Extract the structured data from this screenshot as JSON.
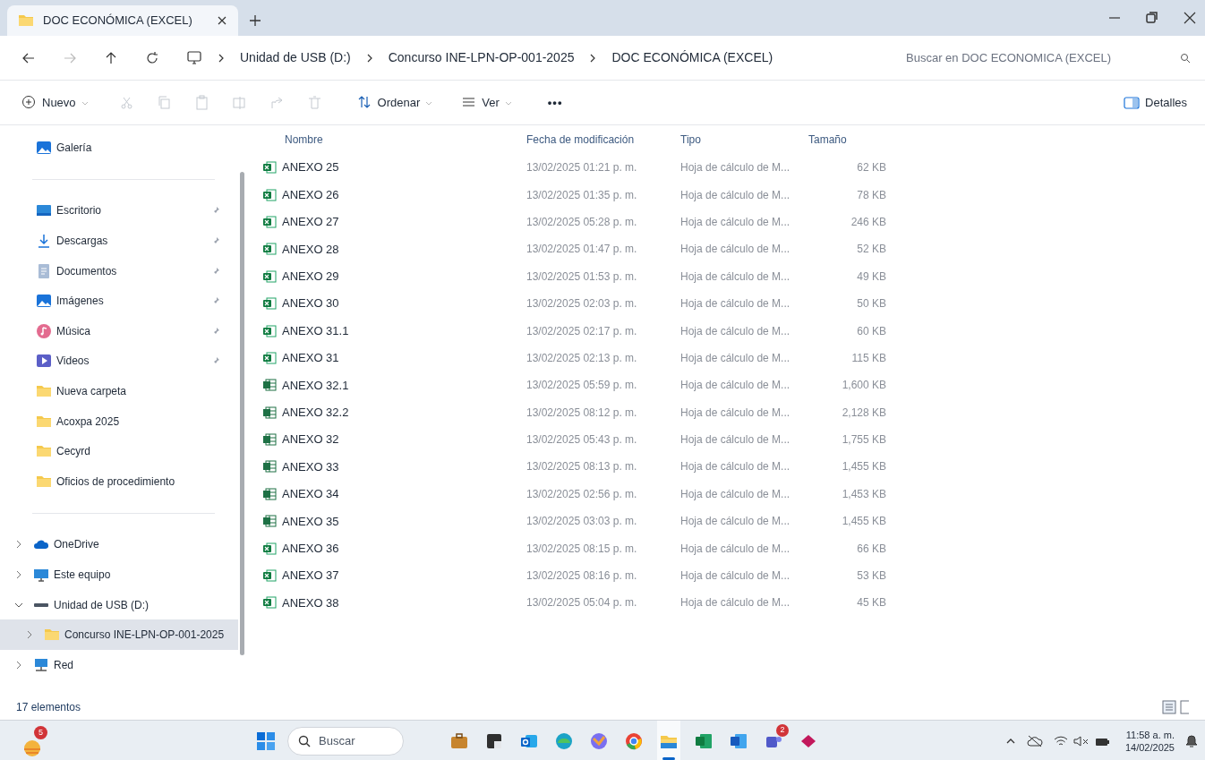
{
  "tabs": [
    {
      "label": "DOC ECONÓMICA (EXCEL)",
      "selected": true
    }
  ],
  "address_bar": {
    "breadcrumbs": [
      "Unidad de USB (D:)",
      "Concurso INE-LPN-OP-001-2025",
      "DOC ECONÓMICA (EXCEL)"
    ]
  },
  "search": {
    "placeholder": "Buscar en DOC ECONOMICA (EXCEL)"
  },
  "toolbar": {
    "items": [
      {
        "kind": "new",
        "label": "Nuevo",
        "disabled": false
      },
      {
        "kind": "cut",
        "disabled": true
      },
      {
        "kind": "copy",
        "disabled": true
      },
      {
        "kind": "paste",
        "disabled": true
      },
      {
        "kind": "rename",
        "disabled": true
      },
      {
        "kind": "share",
        "disabled": true
      },
      {
        "kind": "delete",
        "disabled": true
      },
      {
        "kind": "sort",
        "label": "Ordenar",
        "disabled": false
      },
      {
        "kind": "view",
        "label": "Ver",
        "disabled": false
      },
      {
        "kind": "more",
        "label": "•••",
        "disabled": false
      }
    ],
    "details": "Detalles"
  },
  "sidebar": {
    "top": [
      {
        "kind": "gallery",
        "label": "Galería"
      }
    ],
    "quick_access": [
      {
        "kind": "desktop",
        "label": "Escritorio",
        "pinned": true
      },
      {
        "kind": "download",
        "label": "Descargas",
        "pinned": true
      },
      {
        "kind": "documents",
        "label": "Documentos",
        "pinned": true
      },
      {
        "kind": "pictures",
        "label": "Imágenes",
        "pinned": true
      },
      {
        "kind": "music",
        "label": "Música",
        "pinned": true
      },
      {
        "kind": "videos",
        "label": "Videos",
        "pinned": true
      },
      {
        "kind": "folder",
        "label": "Nueva carpeta",
        "pinned": false
      },
      {
        "kind": "folder",
        "label": "Acoxpa 2025",
        "pinned": false
      },
      {
        "kind": "folder",
        "label": "Cecyrd",
        "pinned": false
      },
      {
        "kind": "folder",
        "label": "Oficios de procedimiento",
        "pinned": false
      }
    ],
    "tree": [
      {
        "kind": "cloud",
        "label": "OneDrive",
        "expanded": false,
        "selected": false
      },
      {
        "kind": "computer",
        "label": "Este equipo",
        "expanded": false,
        "selected": false
      },
      {
        "kind": "drive",
        "label": "Unidad de USB (D:)",
        "expanded": true,
        "selected": false,
        "children": [
          {
            "kind": "folder",
            "label": "Concurso INE-LPN-OP-001-2025",
            "expanded": false,
            "selected": true
          }
        ]
      },
      {
        "kind": "network",
        "label": "Red",
        "expanded": false,
        "selected": false
      }
    ]
  },
  "table": {
    "columns": [
      "Nombre",
      "Fecha de modificación",
      "Tipo",
      "Tamaño"
    ],
    "rows": [
      {
        "kind": "excel",
        "name": "ANEXO 25",
        "date": "13/02/2025 01:21 p. m.",
        "type": "Hoja de cálculo de M...",
        "size": "62 KB"
      },
      {
        "kind": "excel",
        "name": "ANEXO 26",
        "date": "13/02/2025 01:35 p. m.",
        "type": "Hoja de cálculo de M...",
        "size": "78 KB"
      },
      {
        "kind": "excel",
        "name": "ANEXO 27",
        "date": "13/02/2025 05:28 p. m.",
        "type": "Hoja de cálculo de M...",
        "size": "246 KB"
      },
      {
        "kind": "excel",
        "name": "ANEXO 28",
        "date": "13/02/2025 01:47 p. m.",
        "type": "Hoja de cálculo de M...",
        "size": "52 KB"
      },
      {
        "kind": "excel",
        "name": "ANEXO 29",
        "date": "13/02/2025 01:53 p. m.",
        "type": "Hoja de cálculo de M...",
        "size": "49 KB"
      },
      {
        "kind": "excel",
        "name": "ANEXO 30",
        "date": "13/02/2025 02:03 p. m.",
        "type": "Hoja de cálculo de M...",
        "size": "50 KB"
      },
      {
        "kind": "excel",
        "name": "ANEXO 31.1",
        "date": "13/02/2025 02:17 p. m.",
        "type": "Hoja de cálculo de M...",
        "size": "60 KB"
      },
      {
        "kind": "excel",
        "name": "ANEXO 31",
        "date": "13/02/2025 02:13 p. m.",
        "type": "Hoja de cálculo de M...",
        "size": "115 KB"
      },
      {
        "kind": "macro",
        "name": "ANEXO 32.1",
        "date": "13/02/2025 05:59 p. m.",
        "type": "Hoja de cálculo de M...",
        "size": "1,600 KB"
      },
      {
        "kind": "macro",
        "name": "ANEXO 32.2",
        "date": "13/02/2025 08:12 p. m.",
        "type": "Hoja de cálculo de M...",
        "size": "2,128 KB"
      },
      {
        "kind": "macro",
        "name": "ANEXO 32",
        "date": "13/02/2025 05:43 p. m.",
        "type": "Hoja de cálculo de M...",
        "size": "1,755 KB"
      },
      {
        "kind": "macro",
        "name": "ANEXO 33",
        "date": "13/02/2025 08:13 p. m.",
        "type": "Hoja de cálculo de M...",
        "size": "1,455 KB"
      },
      {
        "kind": "macro",
        "name": "ANEXO 34",
        "date": "13/02/2025 02:56 p. m.",
        "type": "Hoja de cálculo de M...",
        "size": "1,453 KB"
      },
      {
        "kind": "macro",
        "name": "ANEXO 35",
        "date": "13/02/2025 03:03 p. m.",
        "type": "Hoja de cálculo de M...",
        "size": "1,455 KB"
      },
      {
        "kind": "excel",
        "name": "ANEXO 36",
        "date": "13/02/2025 08:15 p. m.",
        "type": "Hoja de cálculo de M...",
        "size": "66 KB"
      },
      {
        "kind": "excel",
        "name": "ANEXO 37",
        "date": "13/02/2025 08:16 p. m.",
        "type": "Hoja de cálculo de M...",
        "size": "53 KB"
      },
      {
        "kind": "excel",
        "name": "ANEXO 38",
        "date": "13/02/2025 05:04 p. m.",
        "type": "Hoja de cálculo de M...",
        "size": "45 KB"
      }
    ]
  },
  "status_bar": {
    "count": "17 elementos"
  },
  "taskbar": {
    "widget": {
      "badge": "5"
    },
    "search": {
      "placeholder": "Buscar"
    },
    "apps": [
      {
        "kind": "briefcase",
        "active": false
      },
      {
        "kind": "square",
        "active": false
      },
      {
        "kind": "outlook",
        "active": false
      },
      {
        "kind": "edge",
        "active": false
      },
      {
        "kind": "copilot",
        "active": false
      },
      {
        "kind": "chrome",
        "active": false
      },
      {
        "kind": "explorer",
        "active": true
      },
      {
        "kind": "excel",
        "active": false
      },
      {
        "kind": "word",
        "active": false
      },
      {
        "kind": "teams",
        "active": false,
        "badge": "2"
      },
      {
        "kind": "diamond",
        "active": false
      }
    ],
    "time": "11:58 a. m.",
    "date": "14/02/2025"
  }
}
